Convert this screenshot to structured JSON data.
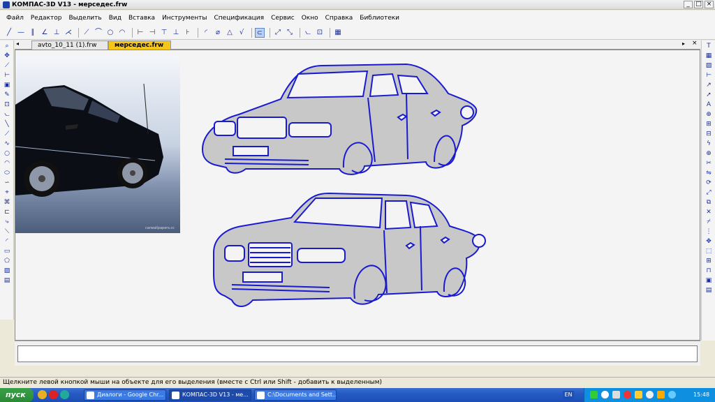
{
  "window": {
    "title": "КОМПАС-3D V13 - мерседес.frw",
    "controls": [
      "_",
      "□",
      "×"
    ]
  },
  "menu": [
    "Файл",
    "Редактор",
    "Выделить",
    "Вид",
    "Вставка",
    "Инструменты",
    "Спецификация",
    "Сервис",
    "Окно",
    "Справка",
    "Библиотеки"
  ],
  "tabs": [
    {
      "label": "avto_10_11 (1).frw",
      "active": false
    },
    {
      "label": "мерседес.frw",
      "active": true
    }
  ],
  "status_hint": "Щелкните левой кнопкой мыши на объекте для его выделения (вместе с Ctrl или Shift - добавить к выделенным)",
  "photo": {
    "watermark": "carwallpapers.cc"
  },
  "taskbar": {
    "start_label": "пуск",
    "items": [
      {
        "label": "Диалоги - Google Chr...",
        "active": false
      },
      {
        "label": "КОМПАС-3D V13 - ме...",
        "active": true
      },
      {
        "label": "C:\\Documents and Sett...",
        "active": false
      }
    ],
    "lang": "EN",
    "clock": "15:48"
  },
  "colors": {
    "accent_tab": "#f5c518",
    "car_fill": "#c8c8c8",
    "car_outline": "#1a1ad0",
    "taskbar": "#245ac4"
  },
  "icons": {
    "toolbar": [
      "line-tool-icon",
      "segment-tool-icon",
      "parallel-tool-icon",
      "angle-tool-icon",
      "circle-tool-icon",
      "arc-tool-icon",
      "dimension-tool-icon",
      "select-tool-icon",
      "magnet-icon",
      "calc-icon"
    ],
    "left": [
      "zoom-icon",
      "pan-icon",
      "geometry-icon",
      "dimension-icon",
      "symbol-icon",
      "edit-icon",
      "param-icon",
      "measure-icon",
      "select-icon",
      "spec-icon",
      "report-icon",
      "insert-icon"
    ],
    "right": [
      "text-icon",
      "table-icon",
      "hatch-icon",
      "dim-icon",
      "leader-icon",
      "arrow-icon",
      "base-icon",
      "tolerance-icon",
      "section-icon",
      "view-icon",
      "cut-icon",
      "axis-icon"
    ]
  }
}
